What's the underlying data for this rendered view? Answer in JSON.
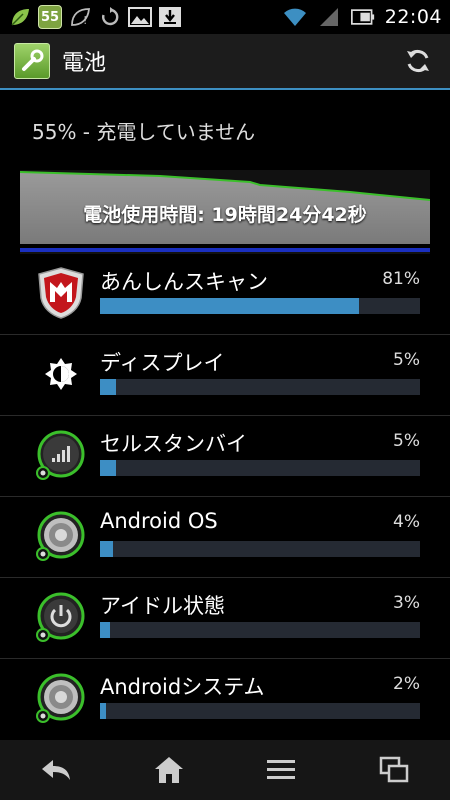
{
  "status_bar": {
    "notification_badge": "55",
    "clock": "22:04"
  },
  "action_bar": {
    "title": "電池",
    "app_icon": "wrench-icon",
    "refresh_icon": "refresh-icon"
  },
  "summary": {
    "status_text": "55% - 充電していません"
  },
  "graph": {
    "label": "電池使用時間: 19時間24分42秒"
  },
  "usage_list": [
    {
      "name": "あんしんスキャン",
      "percent_text": "81%",
      "percent": 81,
      "icon": "mcafee-shield-icon"
    },
    {
      "name": "ディスプレイ",
      "percent_text": "5%",
      "percent": 5,
      "icon": "brightness-icon"
    },
    {
      "name": "セルスタンバイ",
      "percent_text": "5%",
      "percent": 5,
      "icon": "cell-signal-icon"
    },
    {
      "name": "Android OS",
      "percent_text": "4%",
      "percent": 4,
      "icon": "android-os-icon"
    },
    {
      "name": "アイドル状態",
      "percent_text": "3%",
      "percent": 3,
      "icon": "power-icon"
    },
    {
      "name": "Androidシステム",
      "percent_text": "2%",
      "percent": 2,
      "icon": "android-system-icon"
    }
  ],
  "colors": {
    "accent": "#3d8fc2",
    "bar_fill": "#3d8ec4",
    "bar_track": "#252a33",
    "graph_line": "#3bbf2b"
  }
}
